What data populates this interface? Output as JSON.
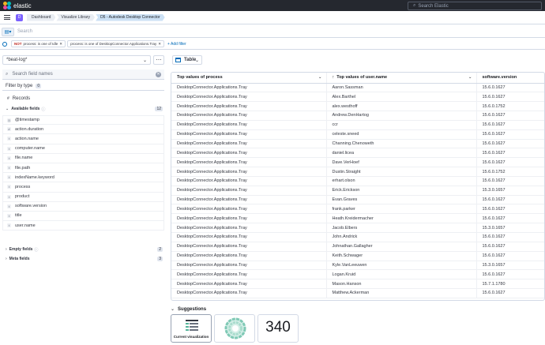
{
  "app": {
    "brand": "elastic",
    "search_placeholder": "Search Elastic"
  },
  "nav": {
    "space_initial": "D",
    "breadcrumbs": [
      "Dashboard",
      "Visualize Library",
      "D5 - Autodesk Desktop Connector"
    ]
  },
  "query": {
    "placeholder": "Search"
  },
  "filters": {
    "pills": [
      {
        "prefix": "NOT",
        "text": "process: is one of Idle"
      },
      {
        "prefix": "",
        "text": "process: is one of DesktopConnector.Applications.Tray"
      }
    ],
    "add_label": "+ Add filter"
  },
  "sidebar": {
    "data_view": "*beat-log*",
    "search_placeholder": "Search field names",
    "filter_by_type": "Filter by type",
    "filter_count": "0",
    "records_label": "Records",
    "available_label": "Available fields",
    "available_count": "12",
    "fields": [
      {
        "token": "◷",
        "name": "@timestamp"
      },
      {
        "token": "#",
        "name": "action.duration"
      },
      {
        "token": "t",
        "name": "action.name"
      },
      {
        "token": "t",
        "name": "computer.name"
      },
      {
        "token": "t",
        "name": "file.name"
      },
      {
        "token": "t",
        "name": "file.path"
      },
      {
        "token": "t",
        "name": "indexName.keyword"
      },
      {
        "token": "t",
        "name": "process"
      },
      {
        "token": "t",
        "name": "product"
      },
      {
        "token": "t",
        "name": "software.version"
      },
      {
        "token": "t",
        "name": "title"
      },
      {
        "token": "t",
        "name": "user.name"
      }
    ],
    "empty_label": "Empty fields",
    "empty_count": "2",
    "meta_label": "Meta fields",
    "meta_count": "3"
  },
  "main": {
    "chart_type": "Table",
    "columns": [
      "Top values of process",
      "Top values of user.name",
      "software.version"
    ],
    "rows": [
      [
        "DesktopConnector.Applications.Tray",
        "Aaron.Sassman",
        "15.6.0.1627"
      ],
      [
        "DesktopConnector.Applications.Tray",
        "Alex.Barthel",
        "15.6.0.1627"
      ],
      [
        "DesktopConnector.Applications.Tray",
        "alex.westhoff",
        "15.6.0.1752"
      ],
      [
        "DesktopConnector.Applications.Tray",
        "Andrew.DenHartog",
        "15.6.0.1627"
      ],
      [
        "DesktopConnector.Applications.Tray",
        "ccr",
        "15.6.0.1627"
      ],
      [
        "DesktopConnector.Applications.Tray",
        "celeste.sneed",
        "15.6.0.1627"
      ],
      [
        "DesktopConnector.Applications.Tray",
        "Channing.Chenoweth",
        "15.6.0.1627"
      ],
      [
        "DesktopConnector.Applications.Tray",
        "daniel.licea",
        "15.6.0.1627"
      ],
      [
        "DesktopConnector.Applications.Tray",
        "Dave.VerHoef",
        "15.6.0.1627"
      ],
      [
        "DesktopConnector.Applications.Tray",
        "Dustin.Straight",
        "15.6.0.1752"
      ],
      [
        "DesktopConnector.Applications.Tray",
        "erhart.olson",
        "15.6.0.1627"
      ],
      [
        "DesktopConnector.Applications.Tray",
        "Erick.Erickson",
        "15.3.0.1657"
      ],
      [
        "DesktopConnector.Applications.Tray",
        "Evan.Graves",
        "15.6.0.1627"
      ],
      [
        "DesktopConnector.Applications.Tray",
        "frank.parker",
        "15.6.0.1627"
      ],
      [
        "DesktopConnector.Applications.Tray",
        "Heath.Kreidermacher",
        "15.6.0.1627"
      ],
      [
        "DesktopConnector.Applications.Tray",
        "Jacob.Elbers",
        "15.3.0.1657"
      ],
      [
        "DesktopConnector.Applications.Tray",
        "John.Andrick",
        "15.6.0.1627"
      ],
      [
        "DesktopConnector.Applications.Tray",
        "Johnathan.Gallagher",
        "15.6.0.1627"
      ],
      [
        "DesktopConnector.Applications.Tray",
        "Keith.Schwager",
        "15.6.0.1627"
      ],
      [
        "DesktopConnector.Applications.Tray",
        "Kyle.VanLeeuwen",
        "15.3.0.1657"
      ],
      [
        "DesktopConnector.Applications.Tray",
        "Logan.Kruid",
        "15.6.0.1627"
      ],
      [
        "DesktopConnector.Applications.Tray",
        "Mason.Hanson",
        "15.7.1.1780"
      ],
      [
        "DesktopConnector.Applications.Tray",
        "Matthew.Ackerman",
        "15.6.0.1627"
      ]
    ],
    "suggestions_label": "Suggestions",
    "current_viz_label": "Current visualization",
    "metric_value": "340"
  }
}
